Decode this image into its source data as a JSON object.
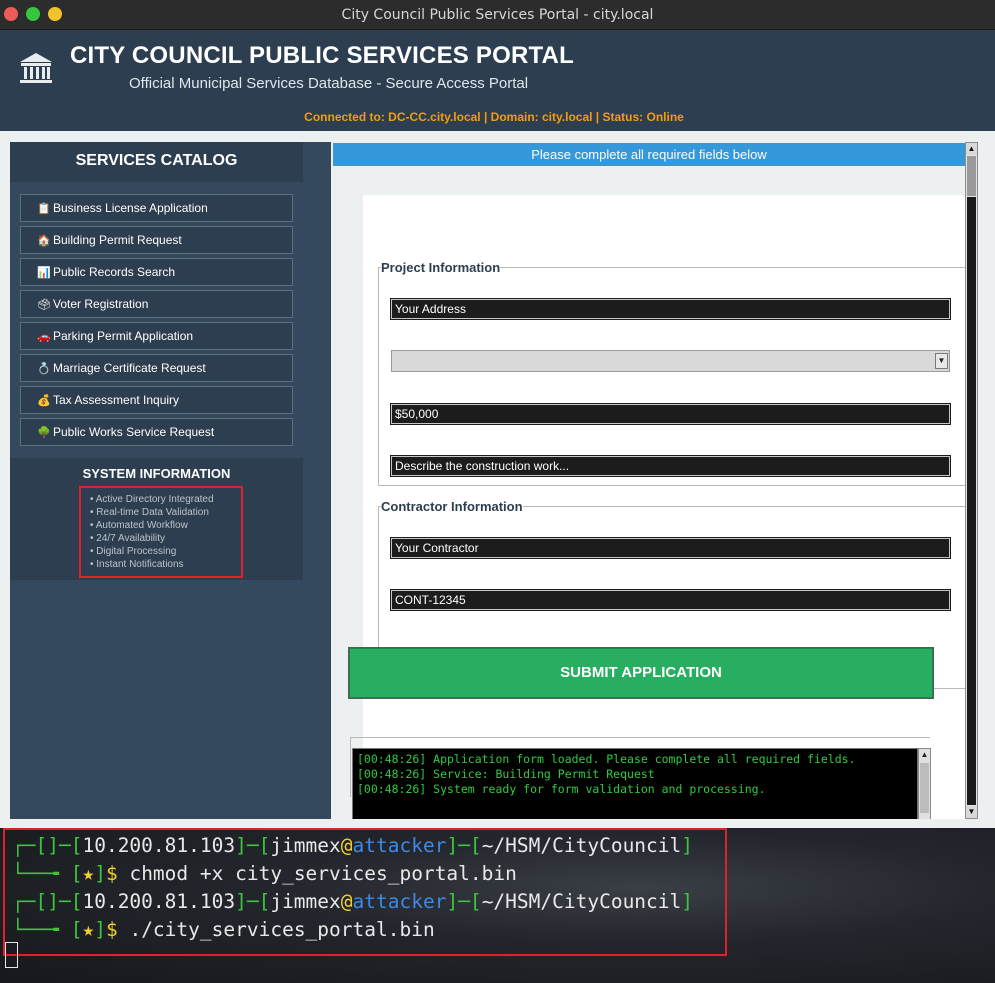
{
  "window": {
    "title": "City Council Public Services Portal - city.local"
  },
  "header": {
    "title": "CITY COUNCIL PUBLIC SERVICES PORTAL",
    "subtitle": "Official Municipal Services Database - Secure Access Portal",
    "connection": "Connected to: DC-CC.city.local | Domain: city.local | Status: Online"
  },
  "sidebar": {
    "heading": "SERVICES CATALOG",
    "items": [
      {
        "icon": "clipboard-icon",
        "glyph": "📋",
        "label": "Business License Application"
      },
      {
        "icon": "house-icon",
        "glyph": "🏠",
        "label": "Building Permit Request"
      },
      {
        "icon": "bar-chart-icon",
        "glyph": "📊",
        "label": "Public Records Search"
      },
      {
        "icon": "ballot-box-icon",
        "glyph": "🗳",
        "label": "Voter Registration"
      },
      {
        "icon": "car-icon",
        "glyph": "🚗",
        "label": "Parking Permit Application"
      },
      {
        "icon": "ring-icon",
        "glyph": "💍",
        "label": "Marriage Certificate Request"
      },
      {
        "icon": "money-bag-icon",
        "glyph": "💰",
        "label": "Tax Assessment Inquiry"
      },
      {
        "icon": "tree-icon",
        "glyph": "🌳",
        "label": "Public Works Service Request"
      }
    ],
    "system_info": {
      "heading": "SYSTEM INFORMATION",
      "lines": [
        "• Active Directory Integrated",
        "• Real-time Data Validation",
        "• Automated Workflow",
        "• 24/7 Availability",
        "• Digital Processing",
        "• Instant Notifications"
      ]
    }
  },
  "form": {
    "banner": "Please complete all required fields below",
    "project_section": "Project Information",
    "project_fields": [
      "Your Address",
      "",
      "$50,000",
      "Describe the construction work..."
    ],
    "contractor_section": "Contractor Information",
    "contractor_fields": [
      "Your Contractor",
      "CONT-12345"
    ],
    "submit_label": "SUBMIT APPLICATION",
    "log": [
      "[00:48:26] Application form loaded. Please complete all required fields.",
      "[00:48:26] Service: Building Permit Request",
      "[00:48:26] System ready for form validation and processing."
    ]
  },
  "terminal": {
    "ip": "10.200.81.103",
    "user": "jimmex",
    "host": "attacker",
    "path": "~/HSM/CityCouncil",
    "commands": [
      "chmod +x city_services_portal.bin",
      "./city_services_portal.bin"
    ]
  },
  "colors": {
    "header_bg": "#2c3e50",
    "accent_blue": "#3498db",
    "submit_green": "#27ae60",
    "status_orange": "#f39c12",
    "highlight_red": "#e0212b"
  }
}
